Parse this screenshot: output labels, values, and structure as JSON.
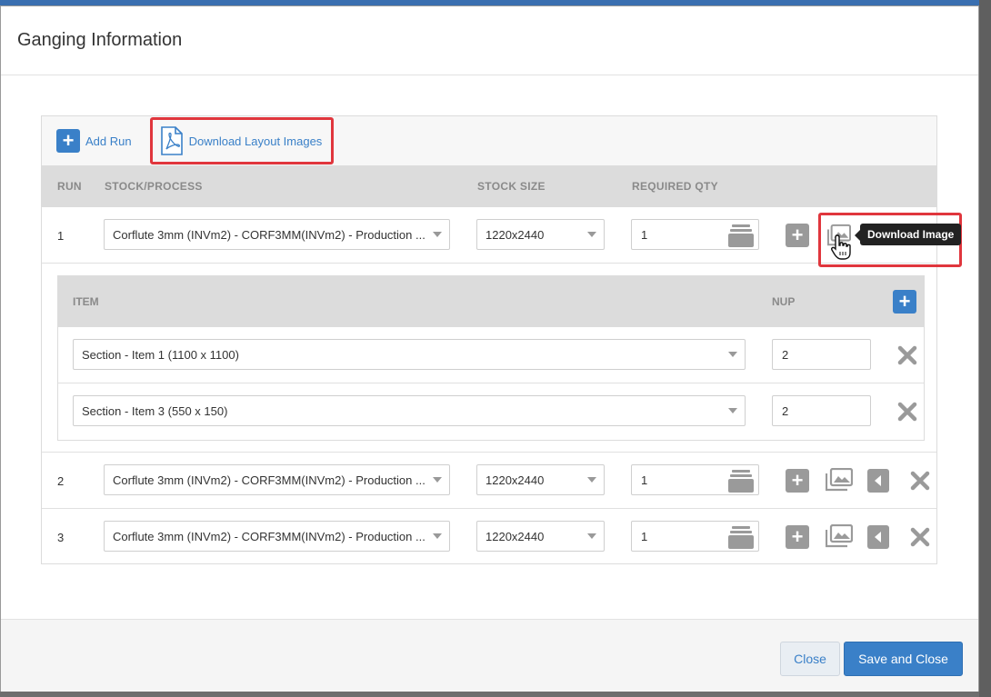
{
  "modal": {
    "title": "Ganging Information"
  },
  "toolbar": {
    "add_run_label": "Add Run",
    "download_layout_label": "Download Layout Images"
  },
  "table": {
    "headers": {
      "run": "RUN",
      "stock": "STOCK/PROCESS",
      "size": "STOCK SIZE",
      "qty": "REQUIRED QTY"
    },
    "rows": [
      {
        "run": "1",
        "stock": "Corflute 3mm (INVm2) - CORF3MM(INVm2) - Production ...",
        "size": "1220x2440",
        "qty": "1"
      },
      {
        "run": "2",
        "stock": "Corflute 3mm (INVm2) - CORF3MM(INVm2) - Production ...",
        "size": "1220x2440",
        "qty": "1"
      },
      {
        "run": "3",
        "stock": "Corflute 3mm (INVm2) - CORF3MM(INVm2) - Production ...",
        "size": "1220x2440",
        "qty": "1"
      }
    ]
  },
  "subtable": {
    "headers": {
      "item": "ITEM",
      "nup": "NUP"
    },
    "rows": [
      {
        "item": "Section - Item 1 (1100 x 1100)",
        "nup": "2"
      },
      {
        "item": "Section - Item 3 (550 x 150)",
        "nup": "2"
      }
    ]
  },
  "tooltip": {
    "text": "Download Image"
  },
  "footer": {
    "close_label": "Close",
    "save_label": "Save and Close"
  },
  "colors": {
    "accent": "#3a80c8",
    "highlight": "#e0363d",
    "icon_grey": "#9a9a9a"
  },
  "icons": [
    "plus-icon",
    "pdf-icon",
    "stack-icon",
    "image-icon",
    "back-icon",
    "close-x-icon",
    "hand-cursor-icon"
  ]
}
